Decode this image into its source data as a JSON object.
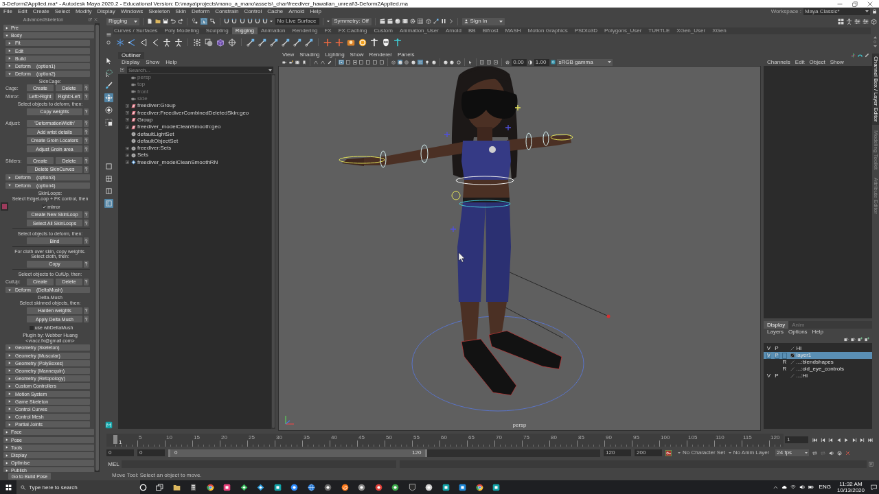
{
  "window": {
    "title": "3-Deform2Applied.ma* - Autodesk Maya 2020.2 - Educational Version: D:\\maya\\projects\\mano_a_mano\\assets\\_char\\freediver_hawaiian_unreal\\3-Deform2Applied.ma"
  },
  "menu_bar": {
    "items": [
      "File",
      "Edit",
      "Create",
      "Select",
      "Modify",
      "Display",
      "Windows",
      "Skeleton",
      "Skin",
      "Deform",
      "Constrain",
      "Control",
      "Cache",
      "Arnold",
      "Help"
    ],
    "workspace_label": "Workspace :",
    "workspace": "Maya Classic*"
  },
  "status_line": {
    "menu_set": "Rigging",
    "select_modes": [
      {
        "kind": "hierarchy",
        "selected": false
      },
      {
        "kind": "object",
        "selected": true
      },
      {
        "kind": "component",
        "selected": false
      }
    ],
    "live_surface": "No Live Surface",
    "symmetry": "Symmetry: Off",
    "account": "Sign In"
  },
  "shelf": {
    "tabs": [
      {
        "label": "Curves / Surfaces",
        "selected": false
      },
      {
        "label": "Poly Modeling",
        "selected": false
      },
      {
        "label": "Sculpting",
        "selected": false
      },
      {
        "label": "Rigging",
        "selected": true
      },
      {
        "label": "Animation",
        "selected": false
      },
      {
        "label": "Rendering",
        "selected": false
      },
      {
        "label": "FX",
        "selected": false
      },
      {
        "label": "FX Caching",
        "selected": false
      },
      {
        "label": "Custom",
        "selected": false
      },
      {
        "label": "Animation_User",
        "selected": false
      },
      {
        "label": "Arnold",
        "selected": false
      },
      {
        "label": "BB",
        "selected": false
      },
      {
        "label": "Bifrost",
        "selected": false
      },
      {
        "label": "MASH",
        "selected": false
      },
      {
        "label": "Motion Graphics",
        "selected": false
      },
      {
        "label": "PSDto3D",
        "selected": false
      },
      {
        "label": "Polygons_User",
        "selected": false
      },
      {
        "label": "TURTLE",
        "selected": false
      },
      {
        "label": "XGen_User",
        "selected": false
      },
      {
        "label": "XGen",
        "selected": false
      }
    ]
  },
  "advanced_skeleton": {
    "title": "AdvancedSkeleton",
    "sections": [
      {
        "label": "Pre",
        "expanded": false
      },
      {
        "label": "Body",
        "expanded": true,
        "children": [
          {
            "label": "Fit",
            "expanded": false
          },
          {
            "label": "Edit",
            "expanded": false
          },
          {
            "label": "Build",
            "expanded": false
          },
          {
            "label": "Deform",
            "variant": "(option1)",
            "expanded": false
          },
          {
            "label": "Deform",
            "variant": "(option2)",
            "expanded": true,
            "content": [
              {
                "kind": "heading",
                "text": "SkinCage:"
              },
              {
                "kind": "buttons",
                "label": "Cage:",
                "buttons": [
                  "Create",
                  "Delete"
                ],
                "help": "?"
              },
              {
                "kind": "buttons",
                "label": "Mirror:",
                "buttons": [
                  "Left>Right",
                  "Right>Left"
                ],
                "help": "?"
              },
              {
                "kind": "note",
                "text": "Select objects to deform, then:"
              },
              {
                "kind": "buttons",
                "buttons": [
                  "Copy weights"
                ],
                "help": "?"
              },
              {
                "kind": "buttons",
                "label": "Adjust:",
                "buttons": [
                  "'DeformationWidth'"
                ],
                "help": "?"
              },
              {
                "kind": "buttons",
                "buttons": [
                  "Add wrist details"
                ],
                "help": "?"
              },
              {
                "kind": "buttons",
                "buttons": [
                  "Create Groin Locators"
                ],
                "help": "?"
              },
              {
                "kind": "buttons",
                "buttons": [
                  "Adjust Groin area"
                ],
                "help": "?"
              },
              {
                "kind": "buttons",
                "label": "Sliders:",
                "buttons": [
                  "Create",
                  "Delete"
                ],
                "help": "?"
              },
              {
                "kind": "buttons",
                "buttons": [
                  "Delete SkinCurves"
                ],
                "help": "?"
              }
            ]
          },
          {
            "label": "Deform",
            "variant": "(option3)",
            "expanded": false
          },
          {
            "label": "Deform",
            "variant": "(option4)",
            "expanded": true,
            "content": [
              {
                "kind": "heading",
                "text": "SkinLoops:"
              },
              {
                "kind": "note",
                "text": "Select EdgeLoop + FK control, then"
              },
              {
                "kind": "checkbox",
                "label": "mirror",
                "checked": true,
                "swatch": true
              },
              {
                "kind": "buttons",
                "buttons": [
                  "Create New SkinLoop"
                ],
                "help": "?"
              },
              {
                "kind": "buttons",
                "buttons": [
                  "Select All SkinLoops"
                ],
                "help": "?"
              },
              {
                "kind": "separator"
              },
              {
                "kind": "note",
                "text": "Select objects to deform, then:"
              },
              {
                "kind": "buttons",
                "buttons": [
                  "Bind"
                ],
                "help": "?"
              },
              {
                "kind": "separator"
              },
              {
                "kind": "note",
                "text": "For cloth over skin, copy weights.\nSelect cloth, then:"
              },
              {
                "kind": "buttons",
                "buttons": [
                  "Copy"
                ],
                "help": "?"
              },
              {
                "kind": "separator"
              },
              {
                "kind": "note",
                "text": "Select objects to CutUp, then:"
              },
              {
                "kind": "buttons",
                "label": "CutUp:",
                "buttons": [
                  "Create",
                  "Delete"
                ],
                "help": "?"
              }
            ]
          },
          {
            "label": "Deform",
            "variant": "(DeltaMush)",
            "expanded": true,
            "content": [
              {
                "kind": "heading",
                "text": "Delta-Mush"
              },
              {
                "kind": "note",
                "text": "Select skinned objects, then:"
              },
              {
                "kind": "buttons",
                "buttons": [
                  "Harden weights"
                ],
                "help": "?"
              },
              {
                "kind": "buttons",
                "buttons": [
                  "Apply Delta Mush"
                ],
                "help": "?"
              },
              {
                "kind": "checkbox",
                "label": "use wbDeltaMush",
                "checked": false
              },
              {
                "kind": "note",
                "text": "Plugin by: Webber Huang\n<vracz.fx@gmail.com>"
              }
            ]
          },
          {
            "label": "Geometry (Skeleton)",
            "expanded": false
          },
          {
            "label": "Geometry (Muscular)",
            "expanded": false
          },
          {
            "label": "Geometry (PolyBoxes)",
            "expanded": false
          },
          {
            "label": "Geometry (Mannequin)",
            "expanded": false
          },
          {
            "label": "Geometry (Retopology)",
            "expanded": false
          },
          {
            "label": "Custom Controllers",
            "expanded": false
          },
          {
            "label": "Motion System",
            "expanded": false
          },
          {
            "label": "Game Skeleton",
            "expanded": false
          },
          {
            "label": "Control Curves",
            "expanded": false
          },
          {
            "label": "Control Mesh",
            "expanded": false
          },
          {
            "label": "Partial Joints",
            "expanded": false
          }
        ]
      },
      {
        "label": "Face",
        "expanded": false
      },
      {
        "label": "Pose",
        "expanded": false
      },
      {
        "label": "Tools",
        "expanded": false
      },
      {
        "label": "Display",
        "expanded": false
      },
      {
        "label": "Optimise",
        "expanded": false
      },
      {
        "label": "Publish",
        "expanded": false
      }
    ],
    "footer_button": "Go to Build Pose"
  },
  "toolbox": {
    "tools": [
      {
        "kind": "select",
        "selected": false
      },
      {
        "kind": "lasso",
        "selected": false
      },
      {
        "kind": "paint",
        "selected": false
      },
      {
        "kind": "move",
        "selected": true
      },
      {
        "kind": "rotate",
        "selected": false
      },
      {
        "kind": "scale",
        "selected": false
      }
    ],
    "layouts": [
      {
        "kind": "single",
        "selected": false
      },
      {
        "kind": "four",
        "selected": false
      },
      {
        "kind": "two",
        "selected": false
      },
      {
        "kind": "outliner",
        "selected": true
      }
    ]
  },
  "outliner": {
    "title": "Outliner",
    "menu": [
      "Display",
      "Show",
      "Help"
    ],
    "search": {
      "placeholder": "Search..."
    },
    "items": [
      {
        "label": "persp",
        "kind": "camera",
        "dimmed": true,
        "expandable": false
      },
      {
        "label": "top",
        "kind": "camera",
        "dimmed": true,
        "expandable": false
      },
      {
        "label": "front",
        "kind": "camera",
        "dimmed": true,
        "expandable": false
      },
      {
        "label": "side",
        "kind": "camera",
        "dimmed": true,
        "expandable": false
      },
      {
        "label": "freediver:Group",
        "kind": "transform",
        "dimmed": false,
        "expandable": true
      },
      {
        "label": "freediver:FreediverCombinedDeletedSkin:geo",
        "kind": "transform",
        "dimmed": false,
        "expandable": true
      },
      {
        "label": "Group",
        "kind": "transform",
        "dimmed": false,
        "expandable": true
      },
      {
        "label": "freediver_modelCleanSmooth:geo",
        "kind": "transform",
        "dimmed": false,
        "expandable": true
      },
      {
        "label": "defaultLightSet",
        "kind": "set",
        "dimmed": false,
        "expandable": false
      },
      {
        "label": "defaultObjectSet",
        "kind": "set",
        "dimmed": false,
        "expandable": false
      },
      {
        "label": "freediver:Sets",
        "kind": "set",
        "dimmed": false,
        "expandable": true
      },
      {
        "label": "Sets",
        "kind": "set",
        "dimmed": false,
        "expandable": true
      },
      {
        "label": "freediver_modelCleanSmoothRN",
        "kind": "reference",
        "dimmed": false,
        "expandable": true
      }
    ]
  },
  "viewport": {
    "menu": [
      "View",
      "Shading",
      "Lighting",
      "Show",
      "Renderer",
      "Panels"
    ],
    "toolbar_groups": [
      {
        "items": [
          {
            "kind": "camera",
            "on": false
          },
          {
            "kind": "camera-lock",
            "on": false
          },
          {
            "kind": "film",
            "on": false
          },
          {
            "kind": "bookmark",
            "on": false
          }
        ]
      },
      {
        "items": [
          {
            "kind": "curve",
            "on": false
          },
          {
            "kind": "curve",
            "on": false
          },
          {
            "kind": "pencil",
            "on": false
          }
        ]
      },
      {
        "items": [
          {
            "kind": "frame-dot",
            "on": true
          },
          {
            "kind": "frame",
            "on": false
          },
          {
            "kind": "frame-dot",
            "on": false
          },
          {
            "kind": "frame",
            "on": false
          },
          {
            "kind": "frame",
            "on": false
          },
          {
            "kind": "frame",
            "on": false
          },
          {
            "kind": "frame",
            "on": false
          }
        ]
      },
      {
        "items": [
          {
            "kind": "cube",
            "on": false
          },
          {
            "kind": "sphere",
            "on": true
          },
          {
            "kind": "sphere-wire",
            "on": false
          },
          {
            "kind": "sphere",
            "on": false
          },
          {
            "kind": "dot-grid",
            "on": true
          },
          {
            "kind": "bulb",
            "on": false
          },
          {
            "kind": "sphere",
            "on": false
          }
        ]
      },
      {
        "items": [
          {
            "kind": "sphere",
            "on": false
          },
          {
            "kind": "sphere",
            "on": false
          },
          {
            "kind": "ring",
            "on": false
          }
        ]
      },
      {
        "items": [
          {
            "kind": "cursor",
            "on": false
          }
        ]
      },
      {
        "items": [
          {
            "kind": "two-pane",
            "on": false
          },
          {
            "kind": "two-pane",
            "on": false
          },
          {
            "kind": "square-x",
            "on": false
          }
        ]
      },
      {
        "items": [
          {
            "kind": "gear",
            "on": false
          }
        ]
      }
    ],
    "exposure": "0.00",
    "gamma": "1.00",
    "color_space": "sRGB gamma",
    "camera": "persp"
  },
  "channel_box": {
    "menu": [
      "Channels",
      "Edit",
      "Object",
      "Show"
    ]
  },
  "layer_editor": {
    "tabs": [
      {
        "label": "Display",
        "selected": true
      },
      {
        "label": "Anim",
        "selected": false
      }
    ],
    "menu": [
      "Layers",
      "Options",
      "Help"
    ],
    "layers": [
      {
        "visibility": "V",
        "playback": "P",
        "name": "Hi",
        "selected": false
      },
      {
        "visibility": "V",
        "playback": "P",
        "name": "layer1",
        "selected": true
      },
      {
        "type": "R",
        "name": "...:blendshapes",
        "selected": false
      },
      {
        "type": "R",
        "name": "...:old_eye_controls",
        "selected": false
      },
      {
        "visibility": "V",
        "playback": "P",
        "name": "...:Hi",
        "selected": false
      }
    ]
  },
  "side_tabs": [
    {
      "label": "Channel Box / Layer Editor",
      "selected": true
    },
    {
      "label": "Modeling Toolkit",
      "selected": false
    },
    {
      "label": "Attribute Editor",
      "selected": false
    }
  ],
  "time_slider": {
    "ticks": [
      "5",
      "10",
      "15",
      "20",
      "25",
      "30",
      "35",
      "40",
      "45",
      "50",
      "55",
      "60",
      "65",
      "70",
      "75",
      "80",
      "85",
      "90",
      "95",
      "100",
      "105",
      "110",
      "115",
      "120"
    ],
    "playhead": {
      "level": 0,
      "label": "1"
    },
    "current_frame": "1"
  },
  "range_slider": {
    "start": "0",
    "range_start": "0",
    "handle": {
      "start": "0",
      "end": "120",
      "level": 0.6
    },
    "range_end": "120",
    "end": "200",
    "character_set": "No Character Set",
    "anim_layer": "No Anim Layer",
    "fps": "24 fps"
  },
  "command_line": {
    "language": "MEL"
  },
  "help_line": "Move Tool: Select an object to move.",
  "taskbar": {
    "search": {
      "placeholder": "Type here to search"
    },
    "language": "ENG",
    "time": "11:32 AM",
    "date": "10/13/2020"
  }
}
